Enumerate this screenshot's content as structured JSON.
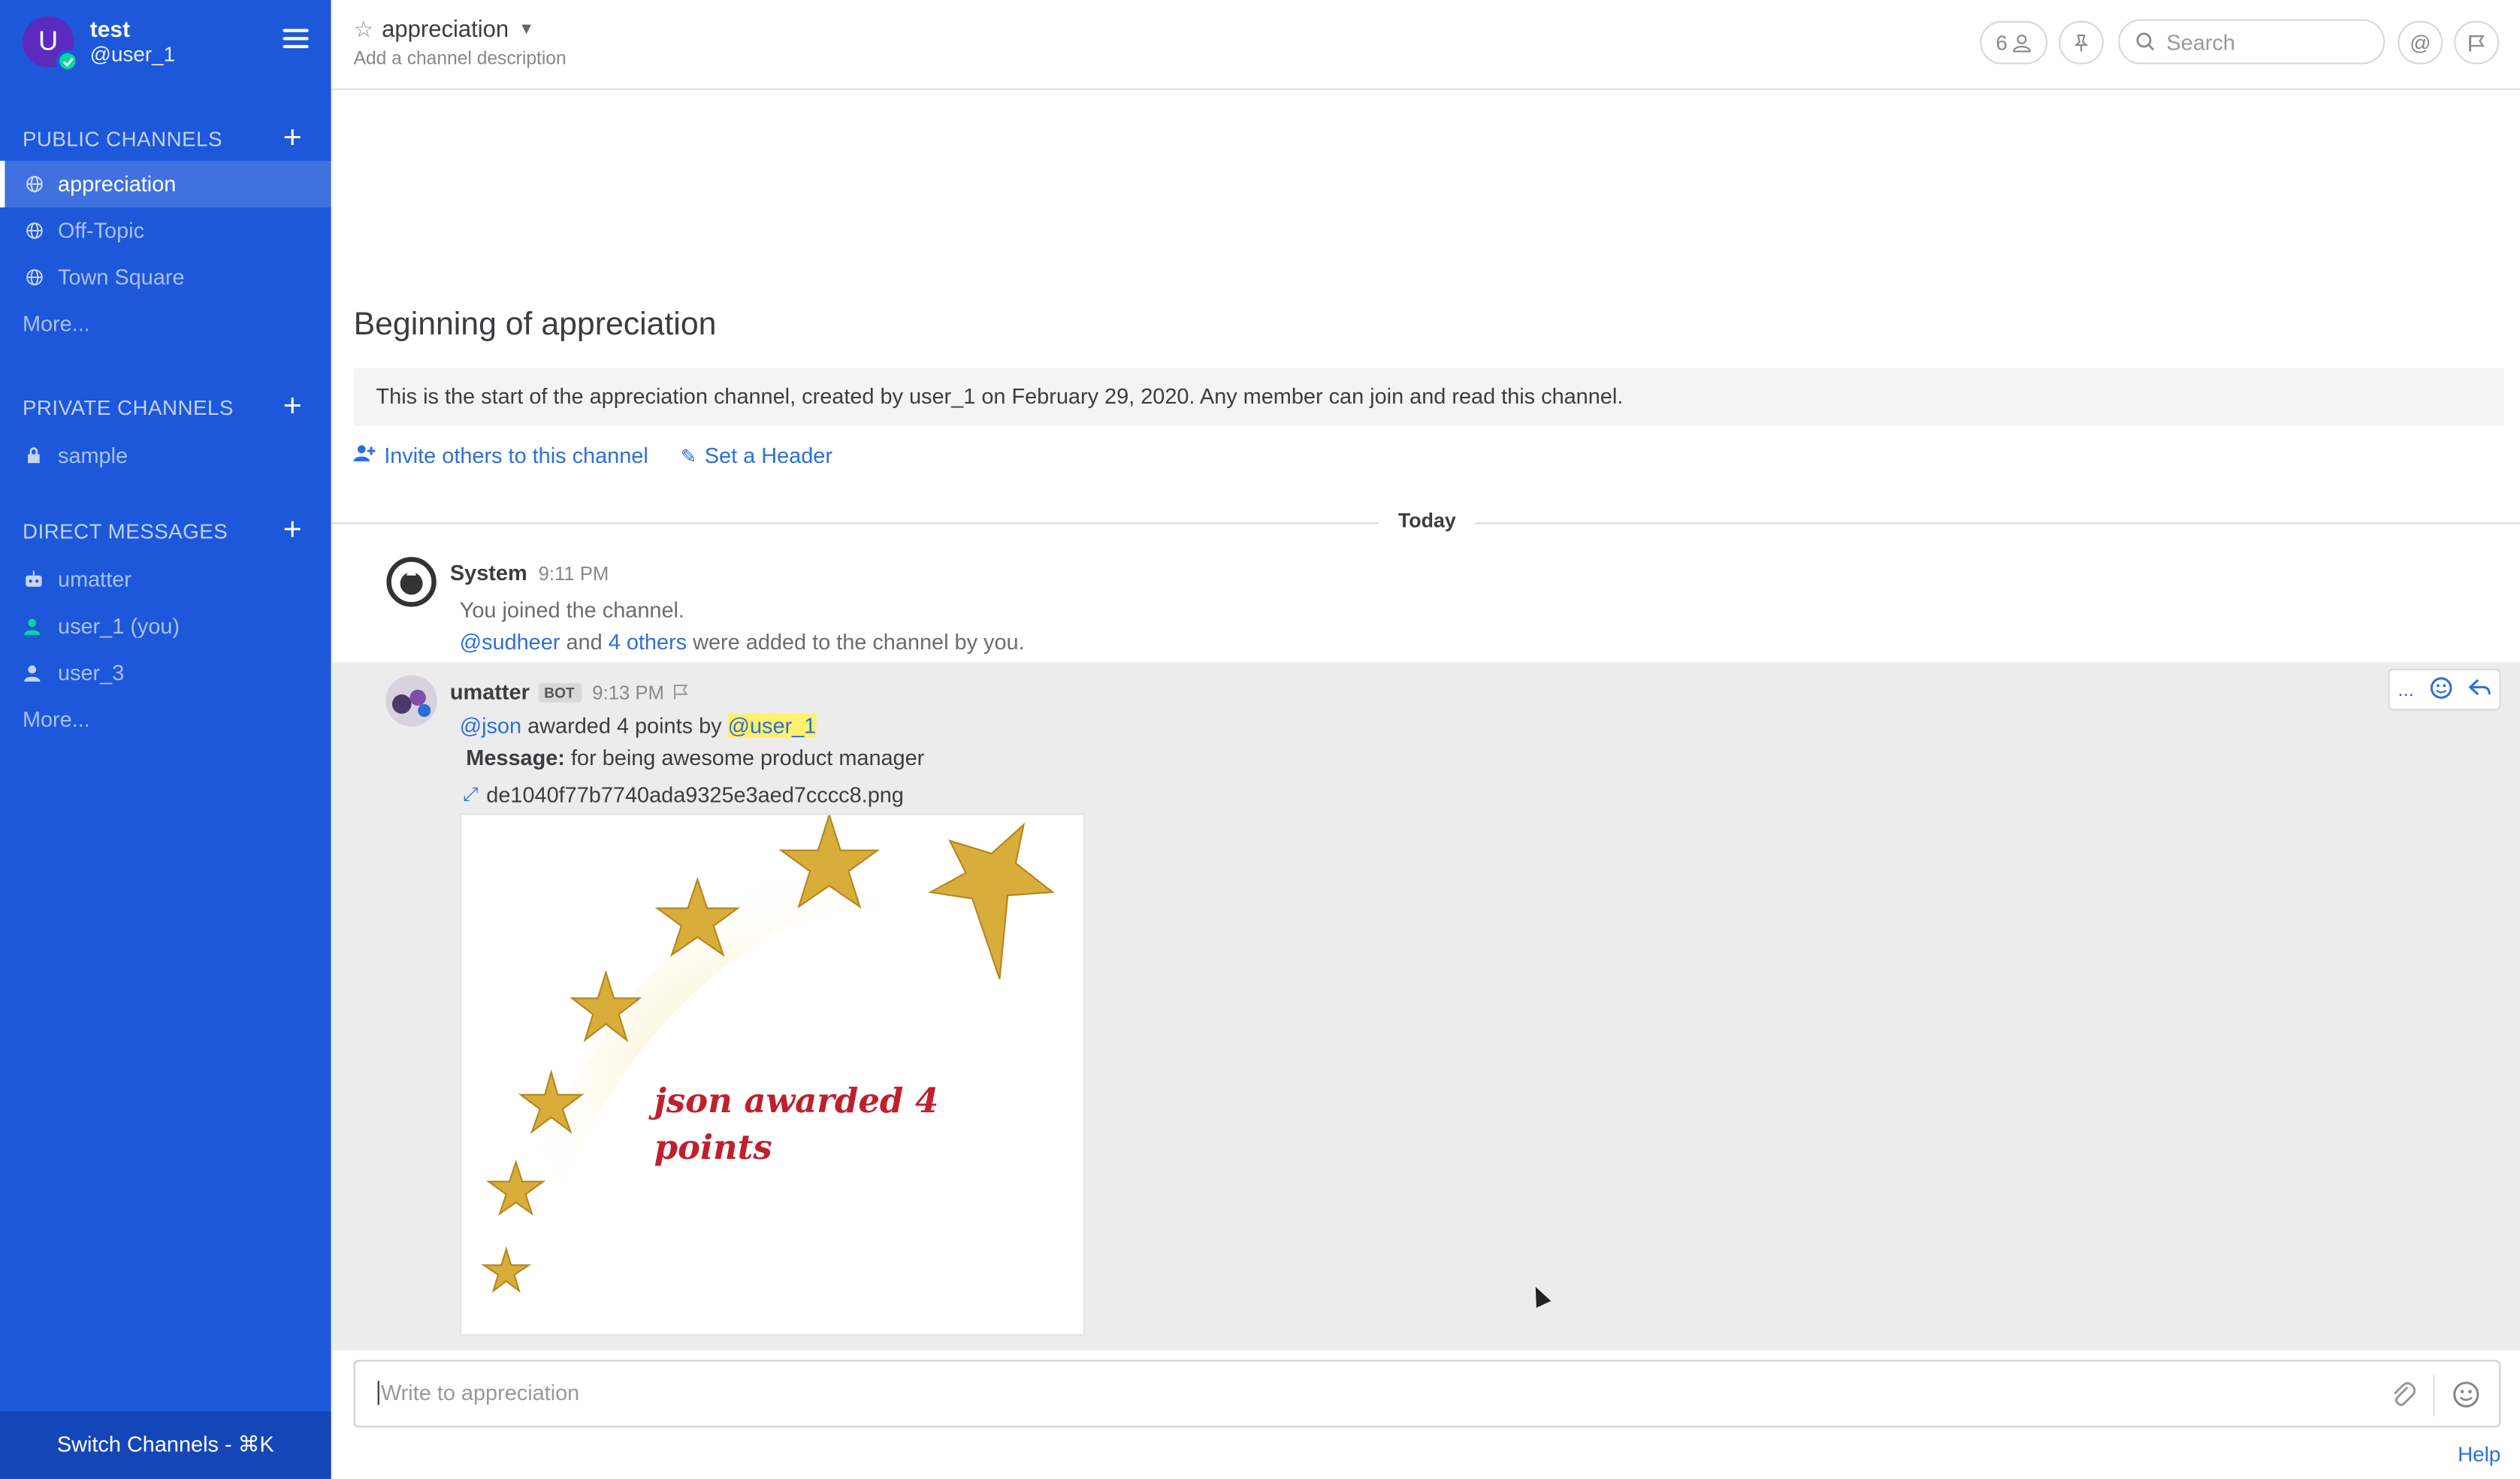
{
  "sidebar": {
    "user": {
      "initial": "U",
      "name": "test",
      "handle": "@user_1"
    },
    "public_title": "PUBLIC CHANNELS",
    "public_channels": [
      "appreciation",
      "Off-Topic",
      "Town Square"
    ],
    "public_more": "More...",
    "private_title": "PRIVATE CHANNELS",
    "private_channels": [
      "sample"
    ],
    "dm_title": "DIRECT MESSAGES",
    "dms": [
      "umatter",
      "user_1 (you)",
      "user_3"
    ],
    "dm_more": "More...",
    "switch_label": "Switch Channels - ⌘K"
  },
  "header": {
    "channel": "appreciation",
    "description": "Add a channel description",
    "member_count": "6",
    "search_placeholder": "Search"
  },
  "intro": {
    "title": "Beginning of appreciation",
    "text": "This is the start of the appreciation channel, created by user_1 on February 29, 2020. Any member can join and read this channel.",
    "invite": "Invite others to this channel",
    "set_header": "Set a Header"
  },
  "date_separator": "Today",
  "posts": {
    "system": {
      "author": "System",
      "time": "9:11 PM",
      "line1": "You joined the channel.",
      "mention1": "@sudheer",
      "and": "and",
      "others": "4 others",
      "added": "were added to the channel by you."
    },
    "bot": {
      "author": "umatter",
      "badge": "BOT",
      "time": "9:13 PM",
      "mention_json": "@json",
      "awarded": "awarded 4 points by",
      "mention_user": "@user_1",
      "message_label": "Message:",
      "message_text": "for being awesome product manager",
      "file_name": "de1040f77b7740ada9325e3aed7cccc8.png",
      "image_text": "json awarded 4 points"
    }
  },
  "composer": {
    "placeholder": "Write to appreciation"
  },
  "help": "Help"
}
